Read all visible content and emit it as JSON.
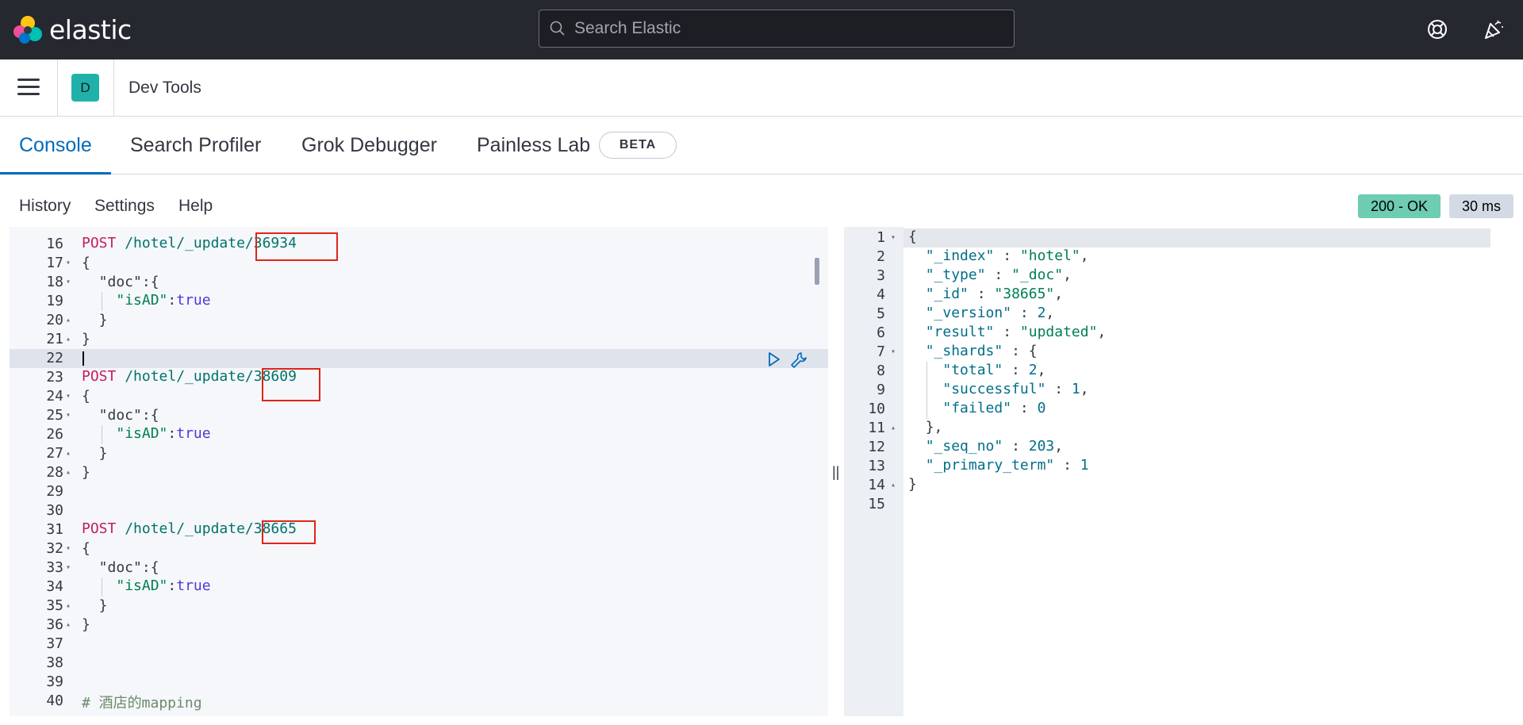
{
  "header": {
    "brand": "elastic",
    "search_placeholder": "Search Elastic",
    "icons": [
      "help-lifebuoy-icon",
      "newsfeed-icon"
    ]
  },
  "appbar": {
    "menu_icon": "hamburger-icon",
    "space_avatar": "D",
    "breadcrumb": "Dev Tools"
  },
  "tabs": [
    {
      "label": "Console",
      "active": true
    },
    {
      "label": "Search Profiler",
      "active": false
    },
    {
      "label": "Grok Debugger",
      "active": false
    },
    {
      "label": "Painless Lab",
      "active": false
    }
  ],
  "beta_badge": "BETA",
  "toolbar": {
    "history": "History",
    "settings": "Settings",
    "help": "Help",
    "status": "200 - OK",
    "duration": "30 ms"
  },
  "request_editor": {
    "lines": [
      {
        "n": "16",
        "fold": "",
        "text": ""
      },
      {
        "n": "17",
        "fold": "▾",
        "text": "{"
      },
      {
        "n": "18",
        "fold": "▾",
        "text": "  \"doc\":{"
      },
      {
        "n": "19",
        "fold": "",
        "text": ""
      },
      {
        "n": "20",
        "fold": "▴",
        "text": "  }"
      },
      {
        "n": "21",
        "fold": "▴",
        "text": "}"
      },
      {
        "n": "22",
        "fold": "",
        "text": ""
      },
      {
        "n": "23",
        "fold": "",
        "text": ""
      },
      {
        "n": "24",
        "fold": "▾",
        "text": "{"
      },
      {
        "n": "25",
        "fold": "▾",
        "text": "  \"doc\":{"
      },
      {
        "n": "26",
        "fold": "",
        "text": ""
      },
      {
        "n": "27",
        "fold": "▴",
        "text": "  }"
      },
      {
        "n": "28",
        "fold": "▴",
        "text": "}"
      },
      {
        "n": "29",
        "fold": "",
        "text": ""
      },
      {
        "n": "30",
        "fold": "",
        "text": ""
      },
      {
        "n": "31",
        "fold": "",
        "text": ""
      },
      {
        "n": "32",
        "fold": "▾",
        "text": "{"
      },
      {
        "n": "33",
        "fold": "▾",
        "text": "  \"doc\":{"
      },
      {
        "n": "34",
        "fold": "",
        "text": ""
      },
      {
        "n": "35",
        "fold": "▴",
        "text": "  }"
      },
      {
        "n": "36",
        "fold": "▴",
        "text": "}"
      },
      {
        "n": "37",
        "fold": "",
        "text": ""
      },
      {
        "n": "38",
        "fold": "",
        "text": ""
      },
      {
        "n": "39",
        "fold": "",
        "text": ""
      },
      {
        "n": "40",
        "fold": "",
        "text": ""
      }
    ],
    "requests": [
      {
        "method": "POST",
        "path": " /hotel/_update/",
        "id": "36934"
      },
      {
        "method": "POST",
        "path": " /hotel/_update/",
        "id": "38609"
      },
      {
        "method": "POST",
        "path": " /hotel/_update/",
        "id": "38665"
      }
    ],
    "doc_field": "\"isAD\"",
    "doc_colon": ":",
    "doc_value": "true",
    "comment": "# 酒店的mapping"
  },
  "response_editor": {
    "lines": [
      {
        "n": "1",
        "fold": "▾"
      },
      {
        "n": "2",
        "fold": ""
      },
      {
        "n": "3",
        "fold": ""
      },
      {
        "n": "4",
        "fold": ""
      },
      {
        "n": "5",
        "fold": ""
      },
      {
        "n": "6",
        "fold": ""
      },
      {
        "n": "7",
        "fold": "▾"
      },
      {
        "n": "8",
        "fold": ""
      },
      {
        "n": "9",
        "fold": ""
      },
      {
        "n": "10",
        "fold": ""
      },
      {
        "n": "11",
        "fold": "▴"
      },
      {
        "n": "12",
        "fold": ""
      },
      {
        "n": "13",
        "fold": ""
      },
      {
        "n": "14",
        "fold": "▴"
      },
      {
        "n": "15",
        "fold": ""
      }
    ],
    "json": {
      "open": "{",
      "index_key": "\"_index\"",
      "index_val": "\"hotel\"",
      "type_key": "\"_type\"",
      "type_val": "\"_doc\"",
      "id_key": "\"_id\"",
      "id_val": "\"38665\"",
      "version_key": "\"_version\"",
      "version_val": "2",
      "result_key": "\"result\"",
      "result_val": "\"updated\"",
      "shards_key": "\"_shards\"",
      "total_key": "\"total\"",
      "total_val": "2",
      "successful_key": "\"successful\"",
      "successful_val": "1",
      "failed_key": "\"failed\"",
      "failed_val": "0",
      "shards_close": "},",
      "seq_key": "\"_seq_no\"",
      "seq_val": "203",
      "term_key": "\"_primary_term\"",
      "term_val": "1",
      "close": "}",
      "sep": " : ",
      "comma": ","
    }
  },
  "actions": {
    "run_icon": "play-icon",
    "wrench_icon": "wrench-icon"
  },
  "colors": {
    "header_bg": "#25282f",
    "accent": "#006bb8",
    "status_ok": "#6dccb1",
    "highlight_box": "#e0241b"
  }
}
